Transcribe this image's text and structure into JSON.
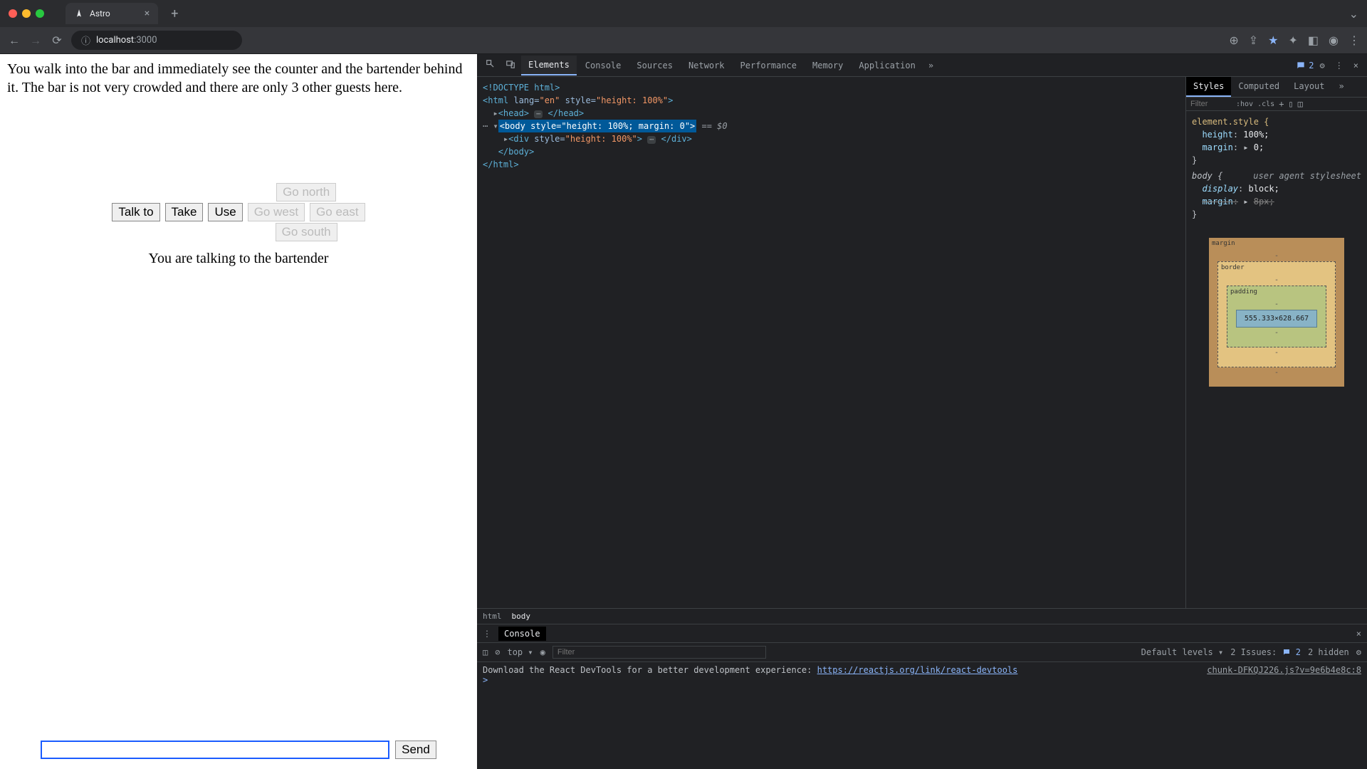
{
  "browser": {
    "tab_title": "Astro",
    "url_host": "localhost",
    "url_rest": ":3000"
  },
  "game": {
    "narrative": "You walk into the bar and immediately see the counter and the bartender behind it. The bar is not very crowded and there are only 3 other guests here.",
    "buttons": {
      "talk": "Talk to",
      "take": "Take",
      "use": "Use",
      "north": "Go north",
      "west": "Go west",
      "east": "Go east",
      "south": "Go south"
    },
    "status": "You are talking to the bartender",
    "send": "Send"
  },
  "devtools": {
    "tabs": [
      "Elements",
      "Console",
      "Sources",
      "Network",
      "Performance",
      "Memory",
      "Application"
    ],
    "active_tab": "Elements",
    "issues_count": "2",
    "dom": {
      "l1": "<!DOCTYPE html>",
      "l2a": "<html ",
      "l2lang": "lang=",
      "l2langv": "\"en\"",
      "l2style": " style=",
      "l2stylev": "\"height: 100%\"",
      "l2b": ">",
      "l3a": "<head>",
      "l3b": "</head>",
      "l4a": "<body ",
      "l4style": "style=",
      "l4stylev": "\"height: 100%; margin: 0\"",
      "l4b": ">",
      "l4eq": " == $0",
      "l5a": "<div ",
      "l5style": "style=",
      "l5stylev": "\"height: 100%\"",
      "l5b": ">",
      "l5c": "</div>",
      "l6": "</body>",
      "l7": "</html>"
    },
    "breadcrumb": [
      "html",
      "body"
    ],
    "styles": {
      "tabs": [
        "Styles",
        "Computed",
        "Layout"
      ],
      "active": "Styles",
      "filter_ph": "Filter",
      "hov": ":hov",
      "cls": ".cls",
      "rule1_sel": "element.style {",
      "rule1_p1": "height",
      "rule1_v1": "100%;",
      "rule1_p2": "margin",
      "rule1_v2": "0;",
      "close": "}",
      "rule2_sel": "body {",
      "agent": "user agent stylesheet",
      "rule2_p1": "display",
      "rule2_v1": "block;",
      "rule2_p2": "margin",
      "rule2_v2": "8px;",
      "bm_margin": "margin",
      "bm_border": "border",
      "bm_padding": "padding",
      "bm_dash": "-",
      "bm_size": "555.333×628.667"
    },
    "console": {
      "title": "Console",
      "top": "top",
      "filter_ph": "Filter",
      "levels": "Default levels",
      "issues_label": "2 Issues:",
      "issues_n": "2",
      "hidden": "2 hidden",
      "source": "chunk-DFKQJ226.js?v=9e6b4e8c:8",
      "msg": "Download the React DevTools for a better development experience: ",
      "link": "https://reactjs.org/link/react-devtools",
      "caret": ">"
    }
  }
}
